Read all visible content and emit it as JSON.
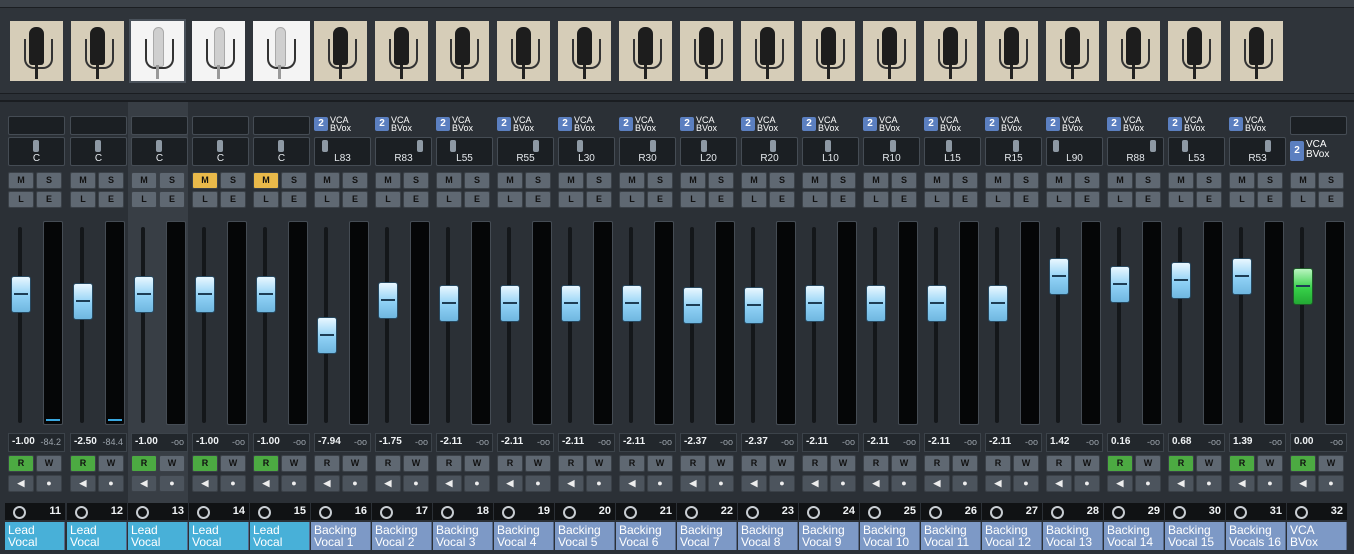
{
  "images": [
    {
      "icon": "microphone-condenser-icon",
      "style": "dark",
      "selected": false
    },
    {
      "icon": "microphone-condenser-icon",
      "style": "dark",
      "selected": false
    },
    {
      "icon": "microphone-pencil-icon",
      "style": "white",
      "selected": true
    },
    {
      "icon": "microphone-pencil-icon",
      "style": "white",
      "selected": false
    },
    {
      "icon": "microphone-condenser-icon",
      "style": "white",
      "selected": false
    },
    {
      "icon": "microphone-condenser-icon",
      "style": "dark",
      "selected": false
    },
    {
      "icon": "microphone-condenser-icon",
      "style": "dark",
      "selected": false
    },
    {
      "icon": "microphone-condenser-icon",
      "style": "dark",
      "selected": false
    },
    {
      "icon": "microphone-condenser-icon",
      "style": "dark",
      "selected": false
    },
    {
      "icon": "microphone-condenser-icon",
      "style": "dark",
      "selected": false
    },
    {
      "icon": "microphone-condenser-icon",
      "style": "dark",
      "selected": false
    },
    {
      "icon": "microphone-condenser-icon",
      "style": "dark",
      "selected": false
    },
    {
      "icon": "microphone-condenser-icon",
      "style": "dark",
      "selected": false
    },
    {
      "icon": "microphone-condenser-icon",
      "style": "dark",
      "selected": false
    },
    {
      "icon": "microphone-condenser-icon",
      "style": "dark",
      "selected": false
    },
    {
      "icon": "microphone-condenser-icon",
      "style": "dark",
      "selected": false
    },
    {
      "icon": "microphone-condenser-icon",
      "style": "dark",
      "selected": false
    },
    {
      "icon": "microphone-condenser-icon",
      "style": "dark",
      "selected": false
    },
    {
      "icon": "microphone-condenser-icon",
      "style": "dark",
      "selected": false
    },
    {
      "icon": "microphone-condenser-icon",
      "style": "dark",
      "selected": false
    },
    {
      "icon": "microphone-condenser-icon",
      "style": "dark",
      "selected": false
    }
  ],
  "labels": {
    "mute": "M",
    "solo": "S",
    "listen": "L",
    "edit": "E",
    "read": "R",
    "write": "W",
    "vca_line1": "VCA",
    "vca_line2": "BVox",
    "vca_num": "2"
  },
  "colors": {
    "lead": "#48b0d8",
    "backing": "#7d99c6",
    "mute_on": "#e9b94a",
    "read_on": "#4caa42",
    "fader": "#8fd0f5",
    "vca_fader": "#37d049"
  },
  "channels": [
    {
      "num": "11",
      "name": "Lead\nVocal",
      "pan": "C",
      "vol": "-1.00",
      "peak": "-84.2",
      "mute": false,
      "read": true,
      "vca": false,
      "level": 0.66,
      "meter": true,
      "selected": false
    },
    {
      "num": "12",
      "name": "Lead\nVocal",
      "pan": "C",
      "vol": "-2.50",
      "peak": "-84.4",
      "mute": false,
      "read": true,
      "vca": false,
      "level": 0.62,
      "meter": true,
      "selected": false
    },
    {
      "num": "13",
      "name": "Lead\nVocal",
      "pan": "C",
      "vol": "-1.00",
      "peak": "-oo",
      "mute": false,
      "read": true,
      "vca": false,
      "level": 0.66,
      "meter": false,
      "selected": true
    },
    {
      "num": "14",
      "name": "Lead\nVocal",
      "pan": "C",
      "vol": "-1.00",
      "peak": "-oo",
      "mute": true,
      "read": true,
      "vca": false,
      "level": 0.66,
      "meter": false,
      "selected": false
    },
    {
      "num": "15",
      "name": "Lead\nVocal",
      "pan": "C",
      "vol": "-1.00",
      "peak": "-oo",
      "mute": true,
      "read": true,
      "vca": false,
      "level": 0.66,
      "meter": false,
      "selected": false
    },
    {
      "num": "16",
      "name": "Backing\nVocal 1",
      "pan": "L83",
      "vol": "-7.94",
      "peak": "-oo",
      "mute": false,
      "read": false,
      "vca": true,
      "level": 0.45,
      "meter": false,
      "selected": false
    },
    {
      "num": "17",
      "name": "Backing\nVocal 2",
      "pan": "R83",
      "vol": "-1.75",
      "peak": "-oo",
      "mute": false,
      "read": false,
      "vca": true,
      "level": 0.63,
      "meter": false,
      "selected": false
    },
    {
      "num": "18",
      "name": "Backing\nVocal 3",
      "pan": "L55",
      "vol": "-2.11",
      "peak": "-oo",
      "mute": false,
      "read": false,
      "vca": true,
      "level": 0.61,
      "meter": false,
      "selected": false
    },
    {
      "num": "19",
      "name": "Backing\nVocal 4",
      "pan": "R55",
      "vol": "-2.11",
      "peak": "-oo",
      "mute": false,
      "read": false,
      "vca": true,
      "level": 0.61,
      "meter": false,
      "selected": false
    },
    {
      "num": "20",
      "name": "Backing\nVocal 5",
      "pan": "L30",
      "vol": "-2.11",
      "peak": "-oo",
      "mute": false,
      "read": false,
      "vca": true,
      "level": 0.61,
      "meter": false,
      "selected": false
    },
    {
      "num": "21",
      "name": "Backing\nVocal 6",
      "pan": "R30",
      "vol": "-2.11",
      "peak": "-oo",
      "mute": false,
      "read": false,
      "vca": true,
      "level": 0.61,
      "meter": false,
      "selected": false
    },
    {
      "num": "22",
      "name": "Backing\nVocal 7",
      "pan": "L20",
      "vol": "-2.37",
      "peak": "-oo",
      "mute": false,
      "read": false,
      "vca": true,
      "level": 0.6,
      "meter": false,
      "selected": false
    },
    {
      "num": "23",
      "name": "Backing\nVocal 8",
      "pan": "R20",
      "vol": "-2.37",
      "peak": "-oo",
      "mute": false,
      "read": false,
      "vca": true,
      "level": 0.6,
      "meter": false,
      "selected": false
    },
    {
      "num": "24",
      "name": "Backing\nVocal 9",
      "pan": "L10",
      "vol": "-2.11",
      "peak": "-oo",
      "mute": false,
      "read": false,
      "vca": true,
      "level": 0.61,
      "meter": false,
      "selected": false
    },
    {
      "num": "25",
      "name": "Backing\nVocal 10",
      "pan": "R10",
      "vol": "-2.11",
      "peak": "-oo",
      "mute": false,
      "read": false,
      "vca": true,
      "level": 0.61,
      "meter": false,
      "selected": false
    },
    {
      "num": "26",
      "name": "Backing\nVocal 11",
      "pan": "L15",
      "vol": "-2.11",
      "peak": "-oo",
      "mute": false,
      "read": false,
      "vca": true,
      "level": 0.61,
      "meter": false,
      "selected": false
    },
    {
      "num": "27",
      "name": "Backing\nVocal 12",
      "pan": "R15",
      "vol": "-2.11",
      "peak": "-oo",
      "mute": false,
      "read": false,
      "vca": true,
      "level": 0.61,
      "meter": false,
      "selected": false
    },
    {
      "num": "28",
      "name": "Backing\nVocal 13",
      "pan": "L90",
      "vol": "1.42",
      "peak": "-oo",
      "mute": false,
      "read": false,
      "vca": true,
      "level": 0.75,
      "meter": false,
      "selected": false
    },
    {
      "num": "29",
      "name": "Backing\nVocal 14",
      "pan": "R88",
      "vol": "0.16",
      "peak": "-oo",
      "mute": false,
      "read": true,
      "vca": true,
      "level": 0.71,
      "meter": false,
      "selected": false
    },
    {
      "num": "30",
      "name": "Backing\nVocal 15",
      "pan": "L53",
      "vol": "0.68",
      "peak": "-oo",
      "mute": false,
      "read": true,
      "vca": true,
      "level": 0.73,
      "meter": false,
      "selected": false
    },
    {
      "num": "31",
      "name": "Backing\nVocals 16",
      "pan": "R53",
      "vol": "1.39",
      "peak": "-oo",
      "mute": false,
      "read": true,
      "vca": true,
      "level": 0.75,
      "meter": false,
      "selected": false
    },
    {
      "num": "32",
      "name": "VCA\nBVox",
      "pan": "",
      "vol": "0.00",
      "peak": "-oo",
      "mute": false,
      "read": true,
      "vca": false,
      "level": 0.7,
      "meter": false,
      "selected": false,
      "is_vca": true
    }
  ]
}
